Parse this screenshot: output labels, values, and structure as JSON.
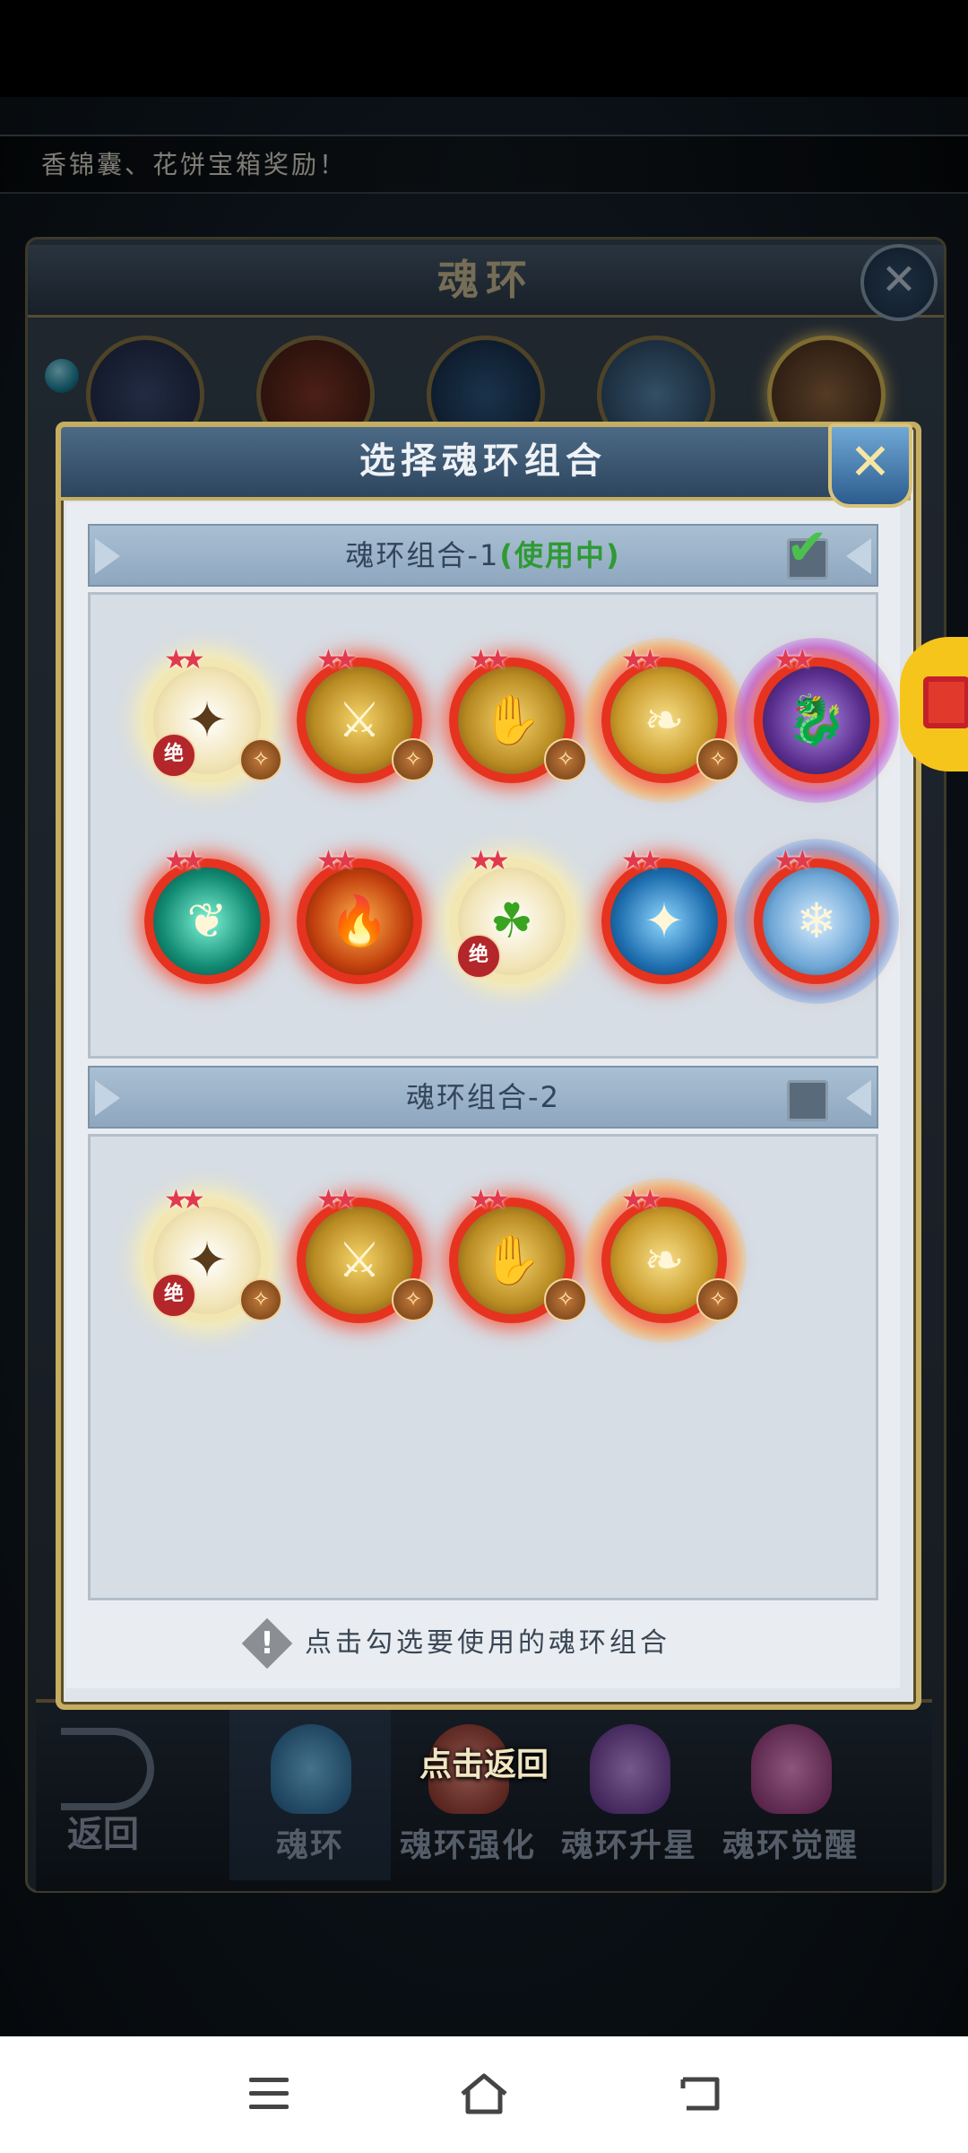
{
  "notice": {
    "text": "香锦囊、花饼宝箱奖励！"
  },
  "back_panel": {
    "title": "魂环",
    "close_symbol": "✕"
  },
  "modal": {
    "title": "选择魂环组合",
    "close_symbol": "✕",
    "groups": [
      {
        "title": "魂环组合-1",
        "status": "(使用中)",
        "checked": true
      },
      {
        "title": "魂环组合-2",
        "status": "",
        "checked": false
      }
    ],
    "hint": "点击勾选要使用的魂环组合",
    "rings": {
      "jue_label": "绝",
      "stars": "★★"
    }
  },
  "bottom_nav": {
    "back_label": "返回",
    "tap_return": "点击返回",
    "tabs": [
      {
        "label": "魂环",
        "active": true
      },
      {
        "label": "魂环强化",
        "active": false
      },
      {
        "label": "魂环升星",
        "active": false
      },
      {
        "label": "魂环觉醒",
        "active": false
      }
    ]
  },
  "colors": {
    "accent_gold": "#c5ad62",
    "in_use_green": "#2f9a34",
    "ring_red": "#e5331f"
  },
  "icons": [
    "close-icon",
    "checkmark-icon",
    "warning-icon",
    "menu-icon",
    "home-icon",
    "back-icon"
  ]
}
